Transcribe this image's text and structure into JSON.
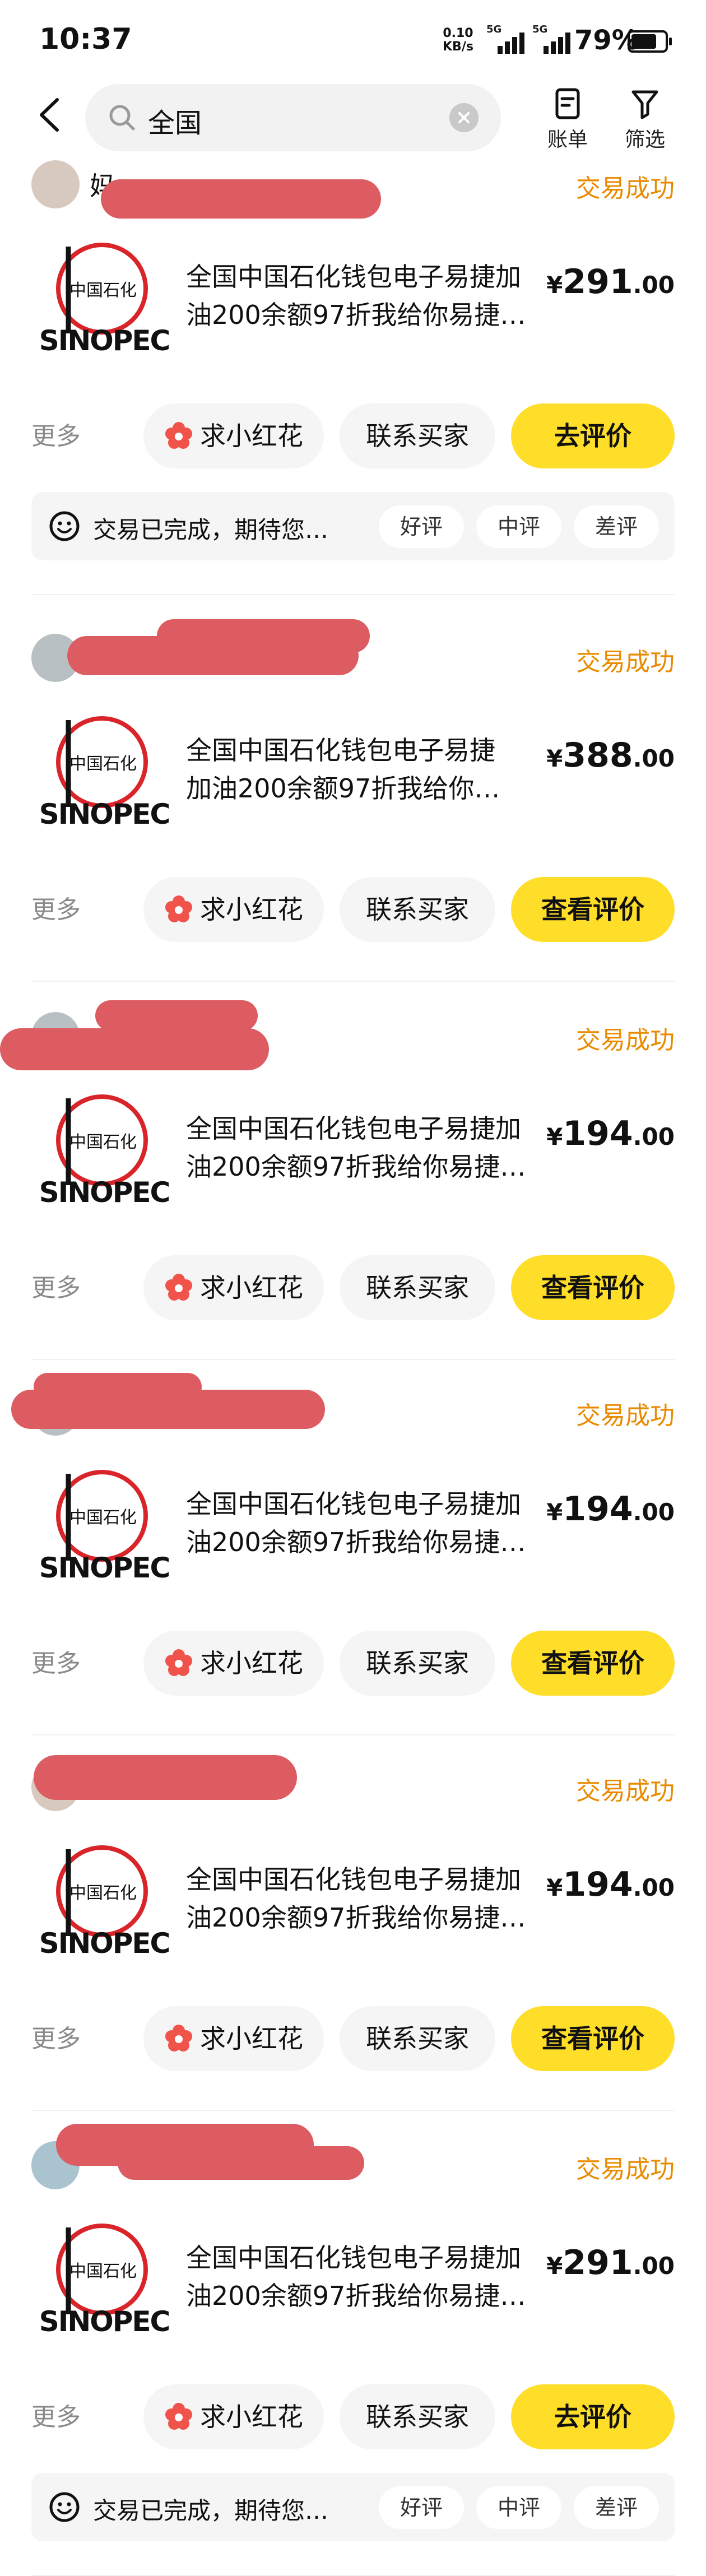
{
  "status_bar": {
    "time": "10:37",
    "net_speed": "0.10",
    "net_unit": "KB/s",
    "sim1": "5G",
    "sim2": "5G",
    "battery": "79%"
  },
  "header": {
    "search_value": "全国",
    "bill_label": "账单",
    "filter_label": "筛选"
  },
  "orders": [
    {
      "user_visible": "妈",
      "user_tail": "…",
      "status": "交易成功",
      "title_line1": "全国中国石化钱包电子易捷加",
      "title_line2": "油200余额97折我给你易捷…",
      "price_currency": "¥",
      "price_int": "291",
      "price_dec": ".00",
      "more": "更多",
      "flower": "求小红花",
      "contact": "联系买家",
      "primary_action": "去评价",
      "feedback": {
        "text": "交易已完成，期待您…",
        "good": "好评",
        "neutral": "中评",
        "bad": "差评"
      }
    },
    {
      "user_visible": "",
      "status": "交易成功",
      "title_line1": "全国中国石化钱包电子易捷",
      "title_line2": "加油200余额97折我给你…",
      "price_currency": "¥",
      "price_int": "388",
      "price_dec": ".00",
      "more": "更多",
      "flower": "求小红花",
      "contact": "联系买家",
      "primary_action": "查看评价"
    },
    {
      "user_visible": "",
      "status": "交易成功",
      "title_line1": "全国中国石化钱包电子易捷加",
      "title_line2": "油200余额97折我给你易捷…",
      "price_currency": "¥",
      "price_int": "194",
      "price_dec": ".00",
      "more": "更多",
      "flower": "求小红花",
      "contact": "联系买家",
      "primary_action": "查看评价"
    },
    {
      "user_visible": "",
      "status": "交易成功",
      "title_line1": "全国中国石化钱包电子易捷加",
      "title_line2": "油200余额97折我给你易捷…",
      "price_currency": "¥",
      "price_int": "194",
      "price_dec": ".00",
      "more": "更多",
      "flower": "求小红花",
      "contact": "联系买家",
      "primary_action": "查看评价"
    },
    {
      "user_visible": "",
      "status": "交易成功",
      "title_line1": "全国中国石化钱包电子易捷加",
      "title_line2": "油200余额97折我给你易捷…",
      "price_currency": "¥",
      "price_int": "194",
      "price_dec": ".00",
      "more": "更多",
      "flower": "求小红花",
      "contact": "联系买家",
      "primary_action": "查看评价"
    },
    {
      "user_visible": "",
      "status": "交易成功",
      "title_line1": "全国中国石化钱包电子易捷加",
      "title_line2": "油200余额97折我给你易捷…",
      "price_currency": "¥",
      "price_int": "291",
      "price_dec": ".00",
      "more": "更多",
      "flower": "求小红花",
      "contact": "联系买家",
      "primary_action": "去评价",
      "feedback": {
        "text": "交易已完成，期待您…",
        "good": "好评",
        "neutral": "中评",
        "bad": "差评"
      }
    }
  ],
  "icons": {
    "back": "chevron-left-icon",
    "search": "search-icon",
    "clear": "clear-icon",
    "bill": "bill-icon",
    "filter": "filter-icon",
    "flower": "flower-icon",
    "feedback": "smiley-icon",
    "logo": "sinopec-logo"
  },
  "colors": {
    "status_success": "#e98a00",
    "primary_button": "#ffde29",
    "redaction": "#dc5c62",
    "flower": "#f0534a",
    "logo_red": "#d9252a"
  }
}
